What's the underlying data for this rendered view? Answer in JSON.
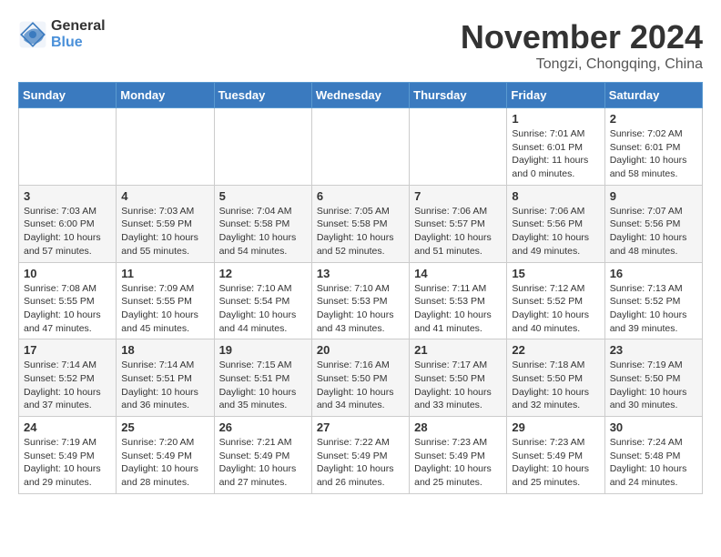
{
  "header": {
    "logo_line1": "General",
    "logo_line2": "Blue",
    "month_title": "November 2024",
    "location": "Tongzi, Chongqing, China"
  },
  "weekdays": [
    "Sunday",
    "Monday",
    "Tuesday",
    "Wednesday",
    "Thursday",
    "Friday",
    "Saturday"
  ],
  "weeks": [
    [
      {
        "day": "",
        "info": ""
      },
      {
        "day": "",
        "info": ""
      },
      {
        "day": "",
        "info": ""
      },
      {
        "day": "",
        "info": ""
      },
      {
        "day": "",
        "info": ""
      },
      {
        "day": "1",
        "info": "Sunrise: 7:01 AM\nSunset: 6:01 PM\nDaylight: 11 hours\nand 0 minutes."
      },
      {
        "day": "2",
        "info": "Sunrise: 7:02 AM\nSunset: 6:01 PM\nDaylight: 10 hours\nand 58 minutes."
      }
    ],
    [
      {
        "day": "3",
        "info": "Sunrise: 7:03 AM\nSunset: 6:00 PM\nDaylight: 10 hours\nand 57 minutes."
      },
      {
        "day": "4",
        "info": "Sunrise: 7:03 AM\nSunset: 5:59 PM\nDaylight: 10 hours\nand 55 minutes."
      },
      {
        "day": "5",
        "info": "Sunrise: 7:04 AM\nSunset: 5:58 PM\nDaylight: 10 hours\nand 54 minutes."
      },
      {
        "day": "6",
        "info": "Sunrise: 7:05 AM\nSunset: 5:58 PM\nDaylight: 10 hours\nand 52 minutes."
      },
      {
        "day": "7",
        "info": "Sunrise: 7:06 AM\nSunset: 5:57 PM\nDaylight: 10 hours\nand 51 minutes."
      },
      {
        "day": "8",
        "info": "Sunrise: 7:06 AM\nSunset: 5:56 PM\nDaylight: 10 hours\nand 49 minutes."
      },
      {
        "day": "9",
        "info": "Sunrise: 7:07 AM\nSunset: 5:56 PM\nDaylight: 10 hours\nand 48 minutes."
      }
    ],
    [
      {
        "day": "10",
        "info": "Sunrise: 7:08 AM\nSunset: 5:55 PM\nDaylight: 10 hours\nand 47 minutes."
      },
      {
        "day": "11",
        "info": "Sunrise: 7:09 AM\nSunset: 5:55 PM\nDaylight: 10 hours\nand 45 minutes."
      },
      {
        "day": "12",
        "info": "Sunrise: 7:10 AM\nSunset: 5:54 PM\nDaylight: 10 hours\nand 44 minutes."
      },
      {
        "day": "13",
        "info": "Sunrise: 7:10 AM\nSunset: 5:53 PM\nDaylight: 10 hours\nand 43 minutes."
      },
      {
        "day": "14",
        "info": "Sunrise: 7:11 AM\nSunset: 5:53 PM\nDaylight: 10 hours\nand 41 minutes."
      },
      {
        "day": "15",
        "info": "Sunrise: 7:12 AM\nSunset: 5:52 PM\nDaylight: 10 hours\nand 40 minutes."
      },
      {
        "day": "16",
        "info": "Sunrise: 7:13 AM\nSunset: 5:52 PM\nDaylight: 10 hours\nand 39 minutes."
      }
    ],
    [
      {
        "day": "17",
        "info": "Sunrise: 7:14 AM\nSunset: 5:52 PM\nDaylight: 10 hours\nand 37 minutes."
      },
      {
        "day": "18",
        "info": "Sunrise: 7:14 AM\nSunset: 5:51 PM\nDaylight: 10 hours\nand 36 minutes."
      },
      {
        "day": "19",
        "info": "Sunrise: 7:15 AM\nSunset: 5:51 PM\nDaylight: 10 hours\nand 35 minutes."
      },
      {
        "day": "20",
        "info": "Sunrise: 7:16 AM\nSunset: 5:50 PM\nDaylight: 10 hours\nand 34 minutes."
      },
      {
        "day": "21",
        "info": "Sunrise: 7:17 AM\nSunset: 5:50 PM\nDaylight: 10 hours\nand 33 minutes."
      },
      {
        "day": "22",
        "info": "Sunrise: 7:18 AM\nSunset: 5:50 PM\nDaylight: 10 hours\nand 32 minutes."
      },
      {
        "day": "23",
        "info": "Sunrise: 7:19 AM\nSunset: 5:50 PM\nDaylight: 10 hours\nand 30 minutes."
      }
    ],
    [
      {
        "day": "24",
        "info": "Sunrise: 7:19 AM\nSunset: 5:49 PM\nDaylight: 10 hours\nand 29 minutes."
      },
      {
        "day": "25",
        "info": "Sunrise: 7:20 AM\nSunset: 5:49 PM\nDaylight: 10 hours\nand 28 minutes."
      },
      {
        "day": "26",
        "info": "Sunrise: 7:21 AM\nSunset: 5:49 PM\nDaylight: 10 hours\nand 27 minutes."
      },
      {
        "day": "27",
        "info": "Sunrise: 7:22 AM\nSunset: 5:49 PM\nDaylight: 10 hours\nand 26 minutes."
      },
      {
        "day": "28",
        "info": "Sunrise: 7:23 AM\nSunset: 5:49 PM\nDaylight: 10 hours\nand 25 minutes."
      },
      {
        "day": "29",
        "info": "Sunrise: 7:23 AM\nSunset: 5:49 PM\nDaylight: 10 hours\nand 25 minutes."
      },
      {
        "day": "30",
        "info": "Sunrise: 7:24 AM\nSunset: 5:48 PM\nDaylight: 10 hours\nand 24 minutes."
      }
    ]
  ]
}
